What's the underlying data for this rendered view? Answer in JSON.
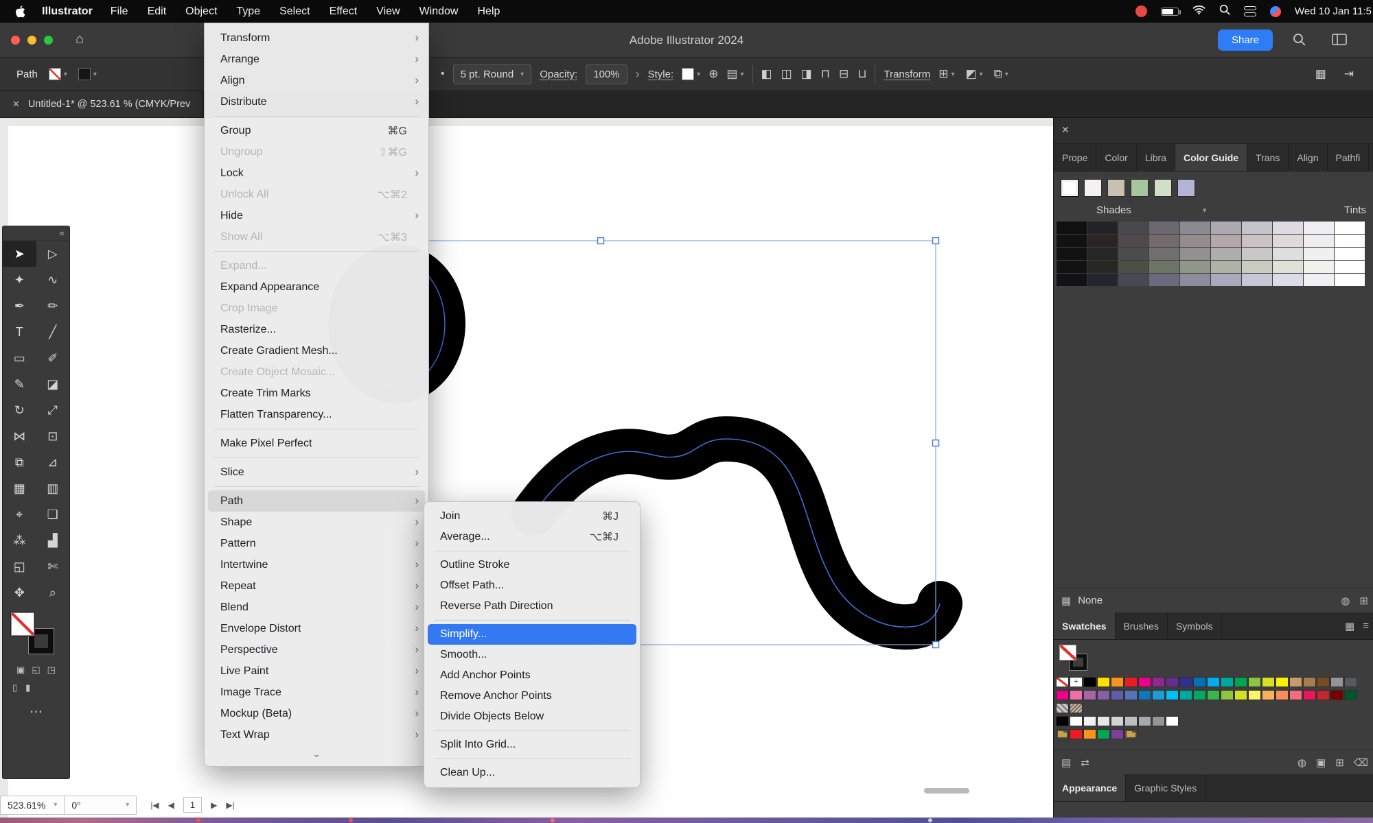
{
  "menubar": {
    "app_name": "Illustrator",
    "items": [
      {
        "label": "File"
      },
      {
        "label": "Edit"
      },
      {
        "label": "Object"
      },
      {
        "label": "Type"
      },
      {
        "label": "Select"
      },
      {
        "label": "Effect"
      },
      {
        "label": "View"
      },
      {
        "label": "Window"
      },
      {
        "label": "Help"
      }
    ],
    "clock": "Wed 10 Jan 11:5"
  },
  "titlebar": {
    "title": "Adobe Illustrator 2024",
    "share_label": "Share",
    "accent": "#2e7cf6"
  },
  "controlbar": {
    "selection_label": "Path",
    "stroke_bullet": "•",
    "brush_definition": "5 pt. Round",
    "opacity_label": "Opacity:",
    "opacity_value": "100%",
    "style_label": "Style:",
    "transform_label": "Transform",
    "align_glyphs": [
      "◧",
      "◫",
      "◨",
      "⊓",
      "⊟",
      "⊔"
    ],
    "extra_icons": [
      {
        "glyph": "⊞",
        "name": "shape-mode-icon"
      },
      {
        "glyph": "◩",
        "name": "pathfinder-icon"
      },
      {
        "glyph": "⧉",
        "name": "isolate-mode-icon"
      }
    ]
  },
  "document_tab": {
    "close": "✕",
    "label": "Untitled-1* @ 523.61 % (CMYK/Prev"
  },
  "object_menu": {
    "items": [
      {
        "label": "Transform",
        "submenu": true
      },
      {
        "label": "Arrange",
        "submenu": true
      },
      {
        "label": "Align",
        "submenu": true
      },
      {
        "label": "Distribute",
        "submenu": true
      },
      {
        "type": "separator"
      },
      {
        "label": "Group",
        "shortcut": "⌘G"
      },
      {
        "label": "Ungroup",
        "shortcut": "⇧⌘G",
        "disabled": true
      },
      {
        "label": "Lock",
        "submenu": true
      },
      {
        "label": "Unlock All",
        "shortcut": "⌥⌘2",
        "disabled": true
      },
      {
        "label": "Hide",
        "submenu": true
      },
      {
        "label": "Show All",
        "shortcut": "⌥⌘3",
        "disabled": true
      },
      {
        "type": "separator"
      },
      {
        "label": "Expand...",
        "disabled": true
      },
      {
        "label": "Expand Appearance"
      },
      {
        "label": "Crop Image",
        "disabled": true
      },
      {
        "label": "Rasterize..."
      },
      {
        "label": "Create Gradient Mesh..."
      },
      {
        "label": "Create Object Mosaic...",
        "disabled": true
      },
      {
        "label": "Create Trim Marks"
      },
      {
        "label": "Flatten Transparency..."
      },
      {
        "type": "separator"
      },
      {
        "label": "Make Pixel Perfect"
      },
      {
        "type": "separator"
      },
      {
        "label": "Slice",
        "submenu": true
      },
      {
        "type": "separator"
      },
      {
        "label": "Path",
        "submenu": true,
        "highlighted": true,
        "name": "menu-item-path"
      },
      {
        "label": "Shape",
        "submenu": true
      },
      {
        "label": "Pattern",
        "submenu": true
      },
      {
        "label": "Intertwine",
        "submenu": true
      },
      {
        "label": "Repeat",
        "submenu": true
      },
      {
        "label": "Blend",
        "submenu": true
      },
      {
        "label": "Envelope Distort",
        "submenu": true
      },
      {
        "label": "Perspective",
        "submenu": true
      },
      {
        "label": "Live Paint",
        "submenu": true
      },
      {
        "label": "Image Trace",
        "submenu": true
      },
      {
        "label": "Mockup (Beta)",
        "submenu": true
      },
      {
        "label": "Text Wrap",
        "submenu": true
      }
    ],
    "more_indicator": "⌄"
  },
  "path_submenu": {
    "items": [
      {
        "label": "Join",
        "shortcut": "⌘J"
      },
      {
        "label": "Average...",
        "shortcut": "⌥⌘J"
      },
      {
        "type": "separator"
      },
      {
        "label": "Outline Stroke"
      },
      {
        "label": "Offset Path..."
      },
      {
        "label": "Reverse Path Direction"
      },
      {
        "type": "separator"
      },
      {
        "label": "Simplify...",
        "highlighted": true,
        "name": "menu-item-simplify"
      },
      {
        "label": "Smooth..."
      },
      {
        "label": "Add Anchor Points"
      },
      {
        "label": "Remove Anchor Points"
      },
      {
        "label": "Divide Objects Below"
      },
      {
        "type": "separator"
      },
      {
        "label": "Split Into Grid..."
      },
      {
        "type": "separator"
      },
      {
        "label": "Clean Up..."
      }
    ]
  },
  "toolbar": {
    "collapse": "«",
    "tools": [
      {
        "glyph": "➤",
        "name": "selection-tool",
        "selected": true
      },
      {
        "glyph": "▷",
        "name": "direct-selection-tool"
      },
      {
        "glyph": "✦",
        "name": "magic-wand-tool"
      },
      {
        "glyph": "∿",
        "name": "lasso-tool"
      },
      {
        "glyph": "✒",
        "name": "pen-tool"
      },
      {
        "glyph": "✏",
        "name": "curvature-tool"
      },
      {
        "glyph": "T",
        "name": "type-tool"
      },
      {
        "glyph": "╱",
        "name": "line-segment-tool"
      },
      {
        "glyph": "▭",
        "name": "rectangle-tool"
      },
      {
        "glyph": "✐",
        "name": "paintbrush-tool"
      },
      {
        "glyph": "✎",
        "name": "pencil-tool"
      },
      {
        "glyph": "◪",
        "name": "eraser-tool"
      },
      {
        "glyph": "↻",
        "name": "rotate-tool"
      },
      {
        "glyph": "⤢",
        "name": "scale-tool"
      },
      {
        "glyph": "⋈",
        "name": "width-tool"
      },
      {
        "glyph": "⊡",
        "name": "free-transform-tool"
      },
      {
        "glyph": "⧉",
        "name": "shape-builder-tool"
      },
      {
        "glyph": "⊿",
        "name": "perspective-grid-tool"
      },
      {
        "glyph": "▦",
        "name": "mesh-tool"
      },
      {
        "glyph": "▥",
        "name": "gradient-tool"
      },
      {
        "glyph": "⌖",
        "name": "eyedropper-tool"
      },
      {
        "glyph": "❏",
        "name": "blend-tool"
      },
      {
        "glyph": "⁂",
        "name": "symbol-sprayer-tool"
      },
      {
        "glyph": "▟",
        "name": "column-graph-tool"
      },
      {
        "glyph": "◱",
        "name": "artboard-tool"
      },
      {
        "glyph": "✄",
        "name": "slice-tool"
      },
      {
        "glyph": "✥",
        "name": "hand-tool"
      },
      {
        "glyph": "⌕",
        "name": "zoom-tool"
      }
    ],
    "mode_glyphs": [
      "▣",
      "◱",
      "◳"
    ],
    "screen_glyphs": [
      "▯",
      "▮"
    ],
    "more": "⋯"
  },
  "right_panel": {
    "close": "✕",
    "tabs": [
      {
        "label": "Prope"
      },
      {
        "label": "Color"
      },
      {
        "label": "Libra"
      },
      {
        "label": "Color Guide",
        "active": true
      },
      {
        "label": "Trans"
      },
      {
        "label": "Align"
      },
      {
        "label": "Pathfi"
      }
    ],
    "color_guide": {
      "base_swatches": [
        {
          "color": "#ffffff",
          "selected": true
        },
        {
          "color": "#f4f1f2"
        },
        {
          "color": "#c9c0b2"
        },
        {
          "color": "#a5c79b"
        },
        {
          "color": "#cfe0c6"
        },
        {
          "color": "#b4b4d6"
        }
      ],
      "shades_label": "Shades",
      "tints_label": "Tints",
      "shade_cells": [
        "#101010",
        "#232226",
        "#4a484d",
        "#6b696f",
        "#8c8a91",
        "#aca9b1",
        "#c6c4cb",
        "#dddbe1",
        "#efeef2",
        "#ffffff",
        "#151112",
        "#2a2425",
        "#50484a",
        "#746a6c",
        "#968b8d",
        "#b3a7a9",
        "#ccc2c4",
        "#e0d9da",
        "#f1edee",
        "#ffffff",
        "#121212",
        "#262626",
        "#4c4c4c",
        "#6f6f6f",
        "#909090",
        "#aeaeae",
        "#c8c8c8",
        "#dedede",
        "#f0f0f0",
        "#ffffff",
        "#111310",
        "#252823",
        "#4a5045",
        "#6d7567",
        "#8f9788",
        "#adb4a5",
        "#c8cdc0",
        "#dee2d8",
        "#f0f2ec",
        "#ffffff",
        "#111116",
        "#24242c",
        "#484855",
        "#6a6a7c",
        "#8c8c9e",
        "#aaaabd",
        "#c6c6d4",
        "#dcdce6",
        "#efeff4",
        "#ffffff"
      ],
      "none_label": "None",
      "footer_icons": [
        {
          "glyph": "◍",
          "name": "limit-colors-icon"
        },
        {
          "glyph": "⊞",
          "name": "save-color-group-icon"
        }
      ]
    },
    "swatch_tabs": [
      {
        "label": "Swatches",
        "active": true
      },
      {
        "label": "Brushes"
      },
      {
        "label": "Symbols"
      }
    ],
    "swatch_view_icons": [
      {
        "glyph": "▦",
        "name": "grid-view-icon"
      },
      {
        "glyph": "≡",
        "name": "list-view-icon"
      }
    ],
    "swatches": {
      "row1": [
        "none",
        "reg",
        "#000000",
        "#ffde00",
        "#f7941d",
        "#ed1c24",
        "#ec008c",
        "#92278f",
        "#662d91",
        "#2e3192",
        "#0072bc",
        "#00aeef",
        "#00a99d",
        "#00a651",
        "#8dc63f",
        "#d9e021",
        "#fff200",
        "#c69c6d",
        "#a97c50",
        "#754c24",
        "#939598",
        "#58595b"
      ],
      "row2": [
        "#ec008c",
        "#f06eaa",
        "#a864a8",
        "#8560a8",
        "#605ca8",
        "#5574b9",
        "#0f75bc",
        "#1b9dd9",
        "#00bff3",
        "#00a99e",
        "#05a763",
        "#39b54a",
        "#8dc63f",
        "#d7df23",
        "#fff568",
        "#fbaf5d",
        "#f68e56",
        "#f26d7d",
        "#ed145b",
        "#c1272d",
        "#790000",
        "#005826"
      ],
      "row3": [
        "pattern",
        "pattern2"
      ],
      "row4": [
        "#000000",
        "#ffffff",
        "#f1f2f2",
        "#e6e7e8",
        "#d1d3d4",
        "#bcbec0",
        "#a7a9ac",
        "#939598",
        "#ffffff"
      ],
      "row5": [
        "folder",
        "#ed1c24",
        "#f7941d",
        "#00a651",
        "#7f3f98",
        "folder"
      ]
    },
    "swatch_footer_left": [
      {
        "glyph": "▤",
        "name": "swatch-libraries-icon"
      },
      {
        "glyph": "⇄",
        "name": "swatch-kinds-icon"
      }
    ],
    "swatch_footer_right": [
      {
        "glyph": "◍",
        "name": "show-kinds-icon"
      },
      {
        "glyph": "▣",
        "name": "new-color-group-icon"
      },
      {
        "glyph": "⊞",
        "name": "new-swatch-icon"
      },
      {
        "glyph": "⌫",
        "name": "delete-swatch-icon"
      }
    ],
    "bottom_tabs": [
      {
        "label": "Appearance",
        "active": true
      },
      {
        "label": "Graphic Styles"
      }
    ]
  },
  "statusbar": {
    "zoom": "523.61%",
    "rotation": "0°",
    "artboard_number": "1",
    "nav_first": "|◀",
    "nav_prev": "◀",
    "nav_next": "▶",
    "nav_last": "▶|"
  },
  "icons": {
    "caret_down": "▾",
    "chevron_right": "›",
    "home": "⌂",
    "globe": "⊕",
    "doc_grid": "▤",
    "grid": "▦",
    "dock": "⇥",
    "menu_more": "⌄"
  },
  "artwork_colors": {
    "stroke": "#000000",
    "center_path": "#3f6cd6",
    "selection_edge": "#85abe4",
    "handle_border": "#4c7fd6"
  }
}
